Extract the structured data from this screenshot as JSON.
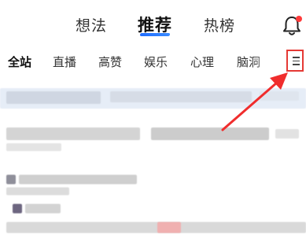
{
  "top_tabs": [
    {
      "label": "想法"
    },
    {
      "label": "推荐",
      "active": true
    },
    {
      "label": "热榜"
    }
  ],
  "channels": [
    {
      "label": "全站",
      "active": true
    },
    {
      "label": "直播"
    },
    {
      "label": "高赞"
    },
    {
      "label": "娱乐"
    },
    {
      "label": "心理"
    },
    {
      "label": "脑洞"
    }
  ],
  "icons": {
    "notification": "bell-icon",
    "channel_menu": "hamburger-menu-icon"
  },
  "colors": {
    "accent": "#1e6cff",
    "badge": "#ff3b3b",
    "highlight": "#e53935"
  }
}
